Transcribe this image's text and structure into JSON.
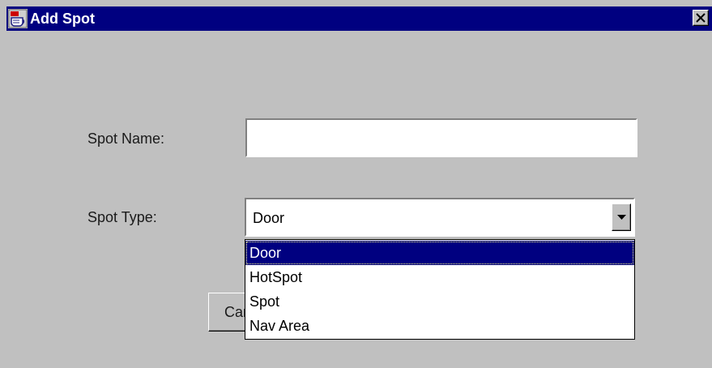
{
  "window": {
    "title": "Add Spot",
    "titlebar_color": "#000080",
    "background_color": "#c0c0c0",
    "icon": "java-cup-icon",
    "close_icon": "close-x-icon"
  },
  "form": {
    "name_label": "Spot Name:",
    "name_value": "",
    "name_placeholder": "",
    "type_label": "Spot Type:",
    "type_value": "Door"
  },
  "dropdown": {
    "options": [
      "Door",
      "HotSpot",
      "Spot",
      "Nav Area"
    ],
    "selected_index": 0,
    "highlight_color": "#000080"
  },
  "buttons": {
    "cancel_label": "Cancel"
  }
}
